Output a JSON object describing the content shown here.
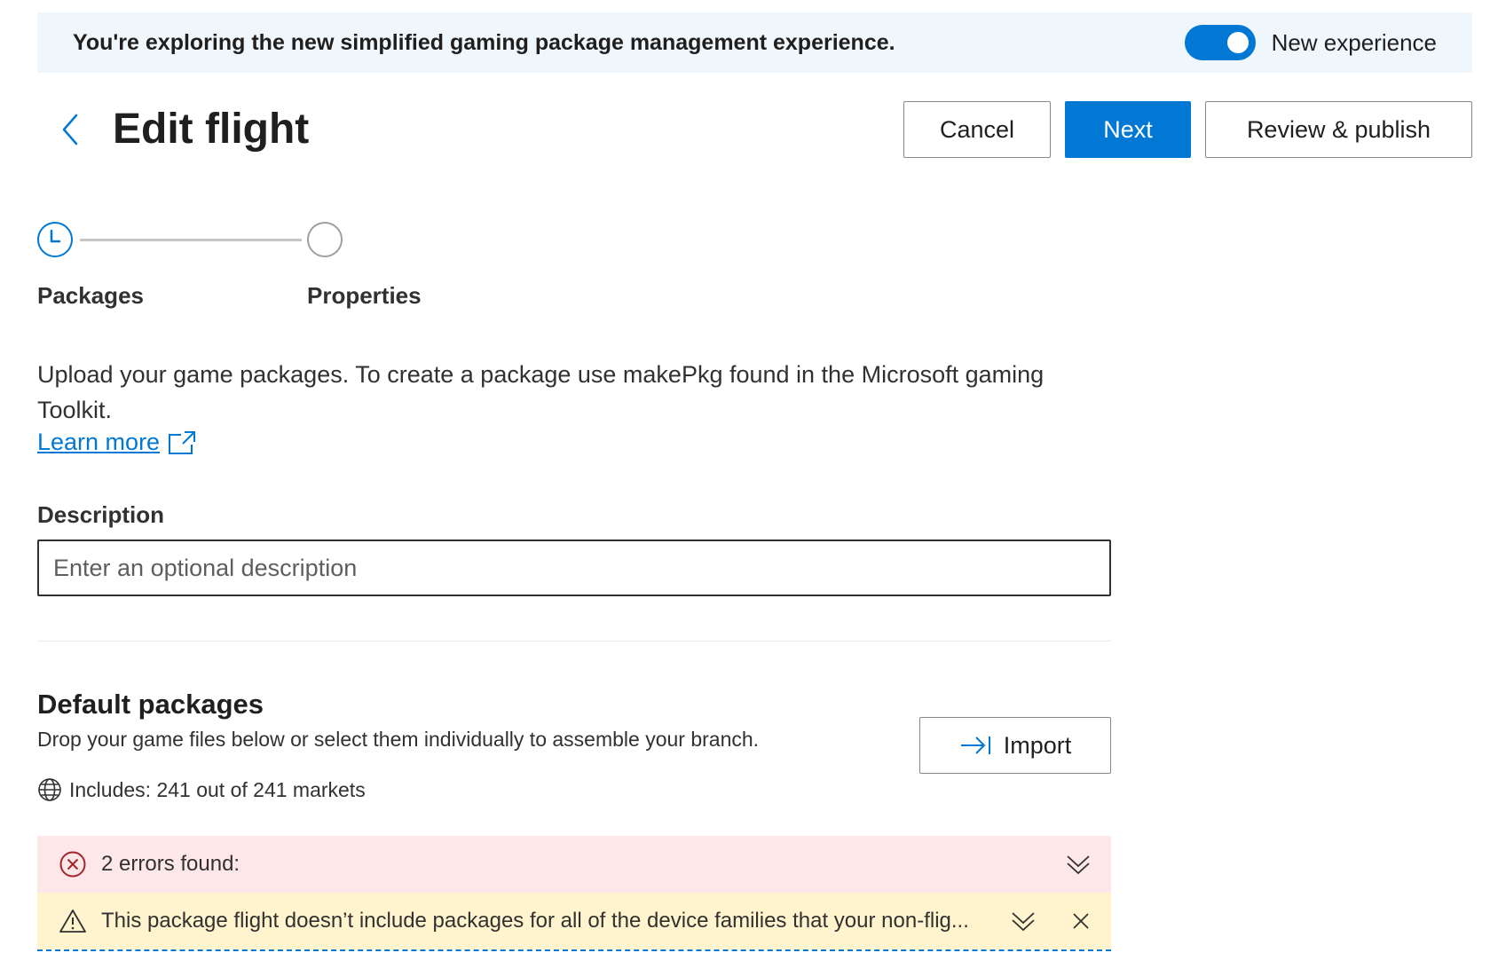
{
  "banner": {
    "message": "You're exploring the new simplified gaming package management experience.",
    "toggle_label": "New experience",
    "toggle_on": true
  },
  "header": {
    "title": "Edit flight",
    "back_icon": "chevron-left-icon",
    "cancel_label": "Cancel",
    "next_label": "Next",
    "review_label": "Review & publish"
  },
  "stepper": {
    "steps": [
      {
        "label": "Packages",
        "state": "current",
        "icon": "clock-icon"
      },
      {
        "label": "Properties",
        "state": "upcoming",
        "icon": "empty-circle"
      }
    ]
  },
  "intro": {
    "text": "Upload your game packages. To create a package use makePkg found in the Microsoft gaming Toolkit.",
    "learn_more": "Learn more"
  },
  "description": {
    "label": "Description",
    "placeholder": "Enter an optional description",
    "value": ""
  },
  "default_packages": {
    "title": "Default packages",
    "subtitle": "Drop your game files below or select them individually to assemble your branch.",
    "import_label": "Import",
    "markets": "Includes: 241 out of 241 markets"
  },
  "alerts": {
    "error": "2 errors found:",
    "warning": "This package flight doesn’t include packages for all of the device families that your non-flig..."
  },
  "colors": {
    "accent": "#0078d4",
    "banner_bg": "#eff6fc",
    "error_bg": "#fde7e9",
    "warning_bg": "#fff4ce",
    "error_icon": "#a4262c"
  }
}
